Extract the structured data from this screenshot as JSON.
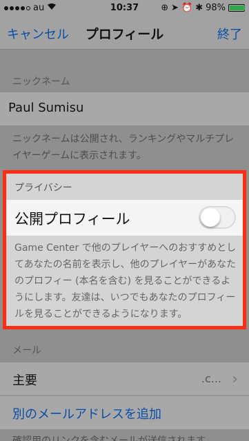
{
  "status": {
    "carrier": "au",
    "time": "10:37",
    "battery": "98%",
    "battery_level": 0.98
  },
  "nav": {
    "cancel": "キャンセル",
    "title": "プロフィール",
    "done": "終了"
  },
  "nickname": {
    "header": "ニックネーム",
    "value": "Paul Sumisu",
    "footer": "ニックネームは公開され、ランキングやマルチプレイヤーゲームに表示されます。"
  },
  "privacy": {
    "header": "プライバシー",
    "toggle_label": "公開プロフィール",
    "toggle_on": false,
    "description": "Game Center で他のプレイヤーへのおすすめとしてあなたの名前を表示し、他のプレイヤーがあなたのプロフィー (本名を含む) を見ることができるようにします。友達は、いつでもあなたのプロフィールを見ることができるようになります。"
  },
  "mail": {
    "header": "メール",
    "primary_label": "主要",
    "primary_value": ".c...",
    "add_link": "別のメールアドレスを追加",
    "footer_partial": "確認用のリンクを含むメールが送信されます"
  }
}
